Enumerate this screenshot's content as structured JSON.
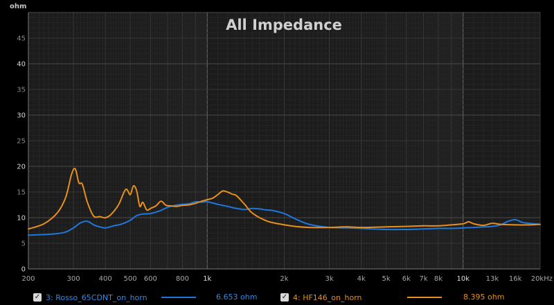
{
  "chart_data": {
    "type": "line",
    "title": "All Impedance",
    "ylabel": "ohm",
    "xscale": "log",
    "xlim": [
      200,
      20000
    ],
    "ylim": [
      0,
      50
    ],
    "grid": true,
    "y_ticks": [
      0,
      5,
      10,
      15,
      20,
      25,
      30,
      35,
      40,
      45
    ],
    "y_tick_labels": [
      "0",
      "5",
      "10",
      "15",
      "20",
      "25",
      "30",
      "35",
      "40",
      "45"
    ],
    "x_ticks": [
      200,
      300,
      400,
      500,
      600,
      800,
      1000,
      2000,
      3000,
      4000,
      5000,
      6000,
      7000,
      8000,
      10000,
      13000,
      16000,
      20000
    ],
    "x_tick_labels": [
      "200",
      "300",
      "400",
      "500",
      "600",
      "800",
      "1k",
      "2k",
      "3k",
      "4k",
      "5k",
      "6k",
      "7k",
      "8k",
      "10k",
      "13k",
      "16k",
      "20kHz"
    ],
    "series": [
      {
        "name": "3: Rosso_65CDNT_on_horn",
        "color": "#1e78dc",
        "x": [
          200,
          230,
          260,
          280,
          300,
          320,
          340,
          360,
          380,
          400,
          430,
          460,
          500,
          530,
          560,
          600,
          650,
          700,
          750,
          800,
          850,
          900,
          950,
          1000,
          1100,
          1200,
          1300,
          1400,
          1500,
          1600,
          1700,
          1800,
          2000,
          2200,
          2500,
          3000,
          3500,
          4000,
          5000,
          6000,
          7000,
          8000,
          9000,
          10000,
          11000,
          12000,
          13000,
          14000,
          15000,
          16000,
          17000,
          18000,
          20000
        ],
        "y": [
          6.6,
          6.7,
          6.9,
          7.2,
          8.0,
          9.0,
          9.3,
          8.6,
          8.2,
          8.0,
          8.4,
          8.7,
          9.5,
          10.4,
          10.7,
          10.8,
          11.3,
          12.0,
          12.4,
          12.6,
          12.7,
          13.1,
          13.0,
          13.1,
          12.6,
          12.2,
          11.8,
          11.6,
          11.8,
          11.7,
          11.5,
          11.4,
          10.8,
          9.8,
          8.7,
          8.1,
          8.0,
          7.9,
          7.7,
          7.7,
          7.8,
          7.9,
          7.9,
          8.0,
          8.1,
          8.2,
          8.3,
          8.6,
          9.3,
          9.6,
          9.1,
          8.9,
          8.7
        ]
      },
      {
        "name": "4: HF146_on_horn",
        "color": "#e8901c",
        "x": [
          200,
          230,
          260,
          280,
          295,
          305,
          315,
          325,
          340,
          360,
          380,
          400,
          420,
          450,
          480,
          500,
          515,
          530,
          545,
          560,
          580,
          600,
          630,
          660,
          690,
          720,
          760,
          800,
          850,
          900,
          950,
          1000,
          1050,
          1100,
          1150,
          1200,
          1250,
          1300,
          1400,
          1500,
          1700,
          1900,
          2200,
          2500,
          3000,
          3500,
          4000,
          5000,
          6000,
          7000,
          8000,
          9000,
          10000,
          10500,
          11000,
          12000,
          13000,
          14000,
          16000,
          18000,
          20000
        ],
        "y": [
          7.8,
          8.8,
          11.0,
          14.0,
          18.5,
          19.5,
          16.8,
          16.5,
          13.0,
          10.3,
          10.2,
          10.0,
          10.6,
          12.5,
          15.5,
          14.5,
          16.2,
          15.2,
          12.2,
          13.0,
          11.5,
          11.8,
          12.3,
          13.2,
          12.4,
          12.3,
          12.2,
          12.4,
          12.5,
          12.8,
          13.2,
          13.5,
          13.8,
          14.5,
          15.2,
          15.0,
          14.6,
          14.3,
          12.6,
          10.9,
          9.4,
          8.8,
          8.3,
          8.1,
          8.1,
          8.2,
          8.1,
          8.2,
          8.3,
          8.4,
          8.4,
          8.6,
          8.8,
          9.2,
          8.8,
          8.5,
          8.9,
          8.7,
          8.6,
          8.6,
          8.7
        ]
      }
    ]
  },
  "legend": {
    "series1": {
      "checkbox": "✓",
      "label": "3: Rosso_65CDNT_on_horn",
      "value": "6.653 ohm",
      "color": "#1e78dc"
    },
    "series2": {
      "checkbox": "✓",
      "label": "4: HF146_on_horn",
      "value": "8.395 ohm",
      "color": "#e8901c"
    }
  }
}
